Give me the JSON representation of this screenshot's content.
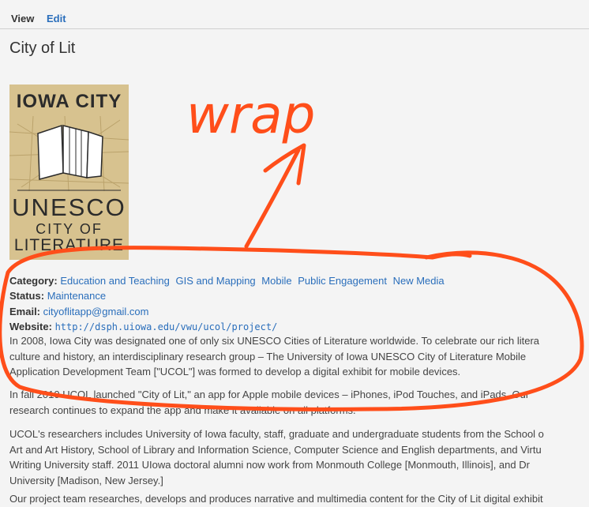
{
  "tabs": {
    "view": "View",
    "edit": "Edit"
  },
  "page_title": "City of Lit",
  "logo": {
    "top": "IOWA CITY",
    "mid": "UNESCO",
    "city": "CITY OF",
    "lit": "LITERATURE"
  },
  "meta": {
    "category_label": "Category:",
    "categories": [
      "Education and Teaching",
      "GIS and Mapping",
      "Mobile",
      "Public Engagement",
      "New Media"
    ],
    "status_label": "Status:",
    "status": "Maintenance",
    "email_label": "Email:",
    "email": "cityoflitapp@gmail.com",
    "website_label": "Website:",
    "website": "http://dsph.uiowa.edu/vwu/ucol/project/"
  },
  "paragraphs": {
    "p1": [
      "In 2008, Iowa City was designated one of only six UNESCO Cities of Literature worldwide. To celebrate our rich litera",
      "culture and history, an interdisciplinary research group – The University of Iowa UNESCO City of Literature Mobile",
      "Application Development Team [\"UCOL\"] was formed to develop a digital exhibit for mobile devices."
    ],
    "p2": [
      "In fall 2010 UCOL launched \"City of Lit,\" an app for Apple mobile devices – iPhones, iPod Touches, and iPads. Our",
      "research continues to expand the app and make it available on all platforms."
    ],
    "p3": [
      "UCOL's researchers includes University of Iowa faculty, staff, graduate and undergraduate students from the School o",
      "Art and Art History, School of Library and Information Science, Computer Science and English departments, and Virtu",
      "Writing University staff. 2011 UIowa doctoral alumni now work from Monmouth College [Monmouth, Illinois], and Dr",
      "University [Madison, New Jersey.]"
    ],
    "p4": [
      "Our project team researches, develops and produces narrative and multimedia content for the City of Lit digital exhibit"
    ]
  },
  "annotation": {
    "text": "wrap",
    "color": "#ff4e1a"
  }
}
